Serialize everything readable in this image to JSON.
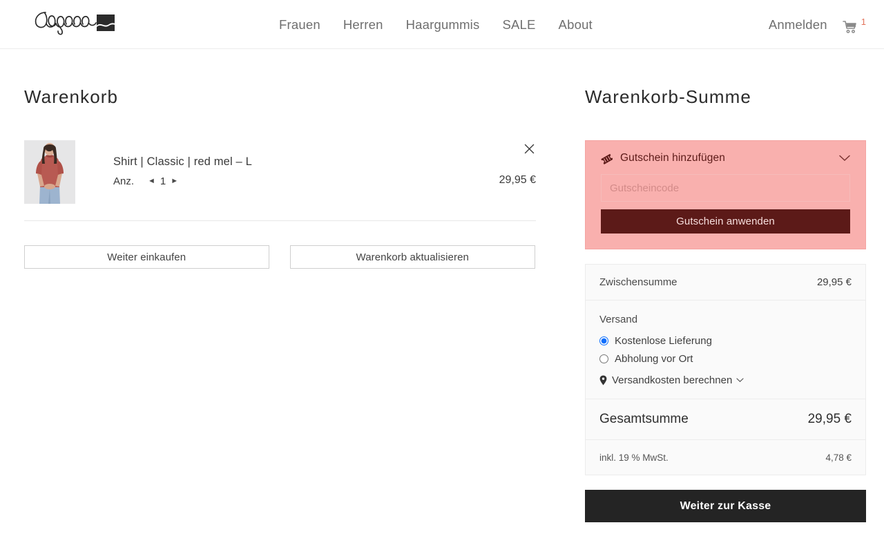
{
  "header": {
    "logo_text": "degree",
    "nav": [
      {
        "label": "Frauen",
        "name": "nav-frauen"
      },
      {
        "label": "Herren",
        "name": "nav-herren"
      },
      {
        "label": "Haargummis",
        "name": "nav-haargummis"
      },
      {
        "label": "SALE",
        "name": "nav-sale"
      },
      {
        "label": "About",
        "name": "nav-about"
      }
    ],
    "signin_label": "Anmelden",
    "cart_icon": "shopping-cart-icon",
    "cart_count": "1",
    "cart_count_color": "#e2725b"
  },
  "cart": {
    "title": "Warenkorb",
    "item": {
      "thumbnail_alt": "model-wearing-red-shirt",
      "name": "Shirt | Classic | red mel – L",
      "qty_label": "Anz.",
      "qty_decrease_icon": "◄",
      "qty_value": "1",
      "qty_increase_icon": "►",
      "price": "29,95 €",
      "remove_icon": "close-icon"
    },
    "continue_label": "Weiter einkaufen",
    "update_label": "Warenkorb aktualisieren"
  },
  "totals": {
    "title": "Warenkorb-Summe",
    "coupon": {
      "icon": "coupon-tag-icon",
      "title": "Gutschein hinzufügen",
      "chevron_icon": "chevron-down-icon",
      "input_placeholder": "Gutscheincode",
      "input_value": "",
      "apply_label": "Gutschein anwenden",
      "panel_bg": "#f9b0ae",
      "button_bg": "#5c1a18"
    },
    "subtotal_label": "Zwischensumme",
    "subtotal_value": "29,95 €",
    "shipping_label": "Versand",
    "shipping_options": [
      {
        "label": "Kostenlose Lieferung",
        "selected": true
      },
      {
        "label": "Abholung vor Ort",
        "selected": false
      }
    ],
    "calc_shipping_label": "Versandkosten berechnen",
    "calc_shipping_icon": "location-pin-icon",
    "calc_shipping_chevron": "chevron-down-icon",
    "grand_total_label": "Gesamtsumme",
    "grand_total_value": "29,95 €",
    "tax_label": "inkl. 19 % MwSt.",
    "tax_value": "4,78 €",
    "checkout_label": "Weiter zur Kasse",
    "checkout_bg": "#242424"
  }
}
